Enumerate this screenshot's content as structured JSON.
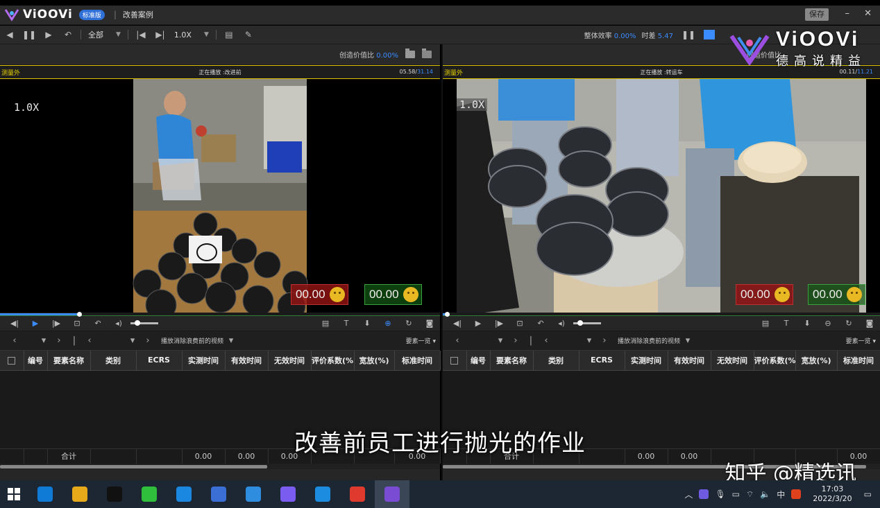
{
  "app": {
    "name": "ViOOVi",
    "edition": "标准版",
    "doc_title": "改善案例",
    "save_label": "保存"
  },
  "toolbar": {
    "filter_value": "全部",
    "speed_value": "1.0X",
    "efficiency_label": "整体效率",
    "efficiency_value": "0.00%",
    "time_diff_label": "时差",
    "time_diff_value": "5.47"
  },
  "left": {
    "value_ratio_label": "创造价值比",
    "value_ratio_value": "0.00%",
    "status": "测量外",
    "playing": "正在播放 :改进前",
    "time_current": "05.58/",
    "time_total": "31.14",
    "speed_overlay": "1.0X",
    "counter_red": "00.00",
    "counter_green": "00.00",
    "progress": 0.18,
    "play_label": "播放消除浪费前的视频",
    "element_list": "要素一览"
  },
  "right": {
    "value_ratio_label": "创造价值比",
    "status": "测量外",
    "playing": "正在播放 :转运车",
    "time_current": "00.11/",
    "time_total": "11.21",
    "speed_overlay": "1.0X",
    "counter_red": "00.00",
    "counter_green": "00.00",
    "progress": 0.01,
    "play_label": "播放消除浪费前的视频",
    "element_list": "要素一览"
  },
  "table": {
    "columns": [
      "编号",
      "要素名称",
      "类别",
      "ECRS",
      "实测时间",
      "有效时间",
      "无效时间",
      "评价系数(%",
      "宽放(%)",
      "标准时间"
    ],
    "total_label": "合计",
    "totals_left": [
      "0.00",
      "0.00",
      "0.00",
      "0.00"
    ],
    "totals_right": [
      "0.00",
      "0.00",
      "0.00"
    ]
  },
  "overlay": {
    "subtitle": "改善前员工进行抛光的作业",
    "watermark_brand": "ViOOVi",
    "watermark_slogan": "德高说精益",
    "zhihu": "知乎 @精选讯"
  },
  "taskbar": {
    "time": "17:03",
    "date": "2022/3/20",
    "ime": "中",
    "apps": [
      "edge",
      "explorer",
      "qq",
      "wechat",
      "photos",
      "app-blue",
      "app-settings",
      "app-purple",
      "app-penguin",
      "wps",
      "viovi"
    ],
    "colors": [
      "#0f7bd6",
      "#e5a91a",
      "#111",
      "#2fbf3c",
      "#1a88e0",
      "#3b6fd6",
      "#2f8de0",
      "#7b5cf0",
      "#1c8ce0",
      "#e03a2e",
      "#7a4bd3"
    ]
  }
}
